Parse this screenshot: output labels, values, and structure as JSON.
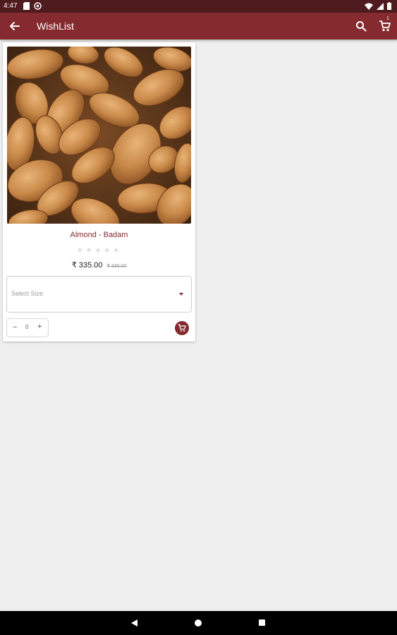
{
  "status_bar": {
    "time": "4:47",
    "icons_left": [
      "sd-card-icon",
      "at-sign-icon"
    ],
    "icons_right": [
      "wifi-icon",
      "signal-icon",
      "battery-icon"
    ]
  },
  "app_bar": {
    "title": "WishList",
    "cart_badge": "1",
    "colors": {
      "primary": "#852b30",
      "status": "#4f1b1f"
    }
  },
  "product": {
    "name": "Almond - Badam",
    "rating_stars": "★★★★★",
    "rating": 0,
    "price": "₹ 335.00",
    "mrp": "₹ 335.00",
    "size_placeholder": "Select Size",
    "quantity": "0",
    "minus_label": "−",
    "plus_label": "+"
  }
}
